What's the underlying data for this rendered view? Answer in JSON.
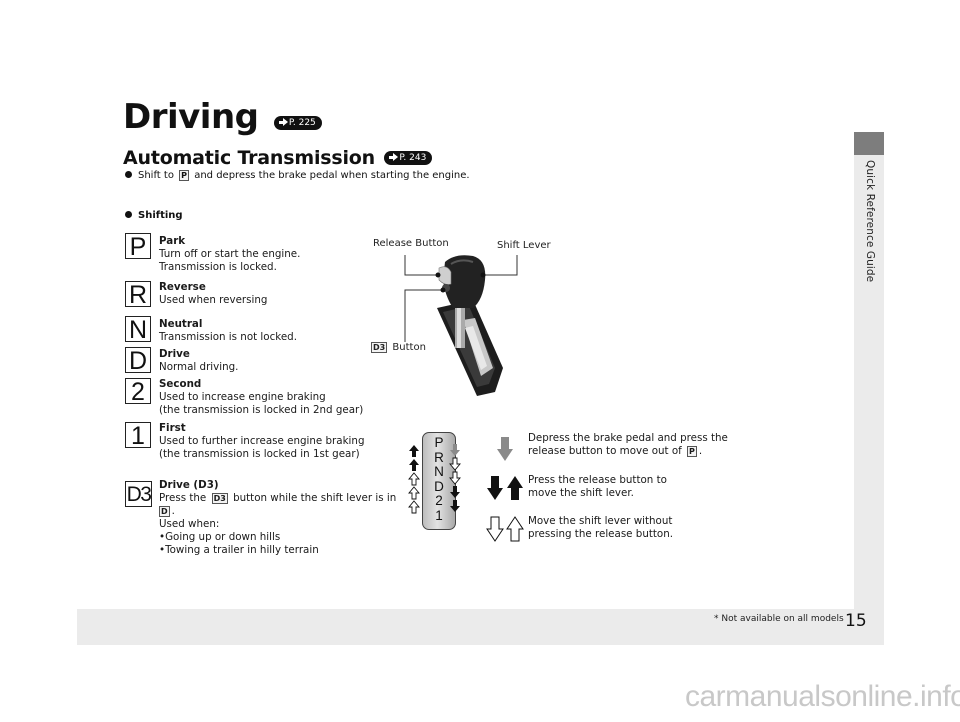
{
  "page": {
    "title": "Driving",
    "title_ref": "P. 225",
    "section": "Automatic Transmission",
    "section_ref": "P. 243",
    "intro_bullet": {
      "before": "Shift to",
      "key": "P",
      "after": "and depress the brake pedal when starting the engine."
    },
    "subsection": "Shifting",
    "side_tab_label": "Quick Reference Guide",
    "footnote": "* Not available on all models",
    "page_number": "15",
    "watermark": "carmanualsonline.info"
  },
  "gears": [
    {
      "symbol": "P",
      "name": "Park",
      "lines": [
        "Turn off or start the engine.",
        "Transmission is locked."
      ]
    },
    {
      "symbol": "R",
      "name": "Reverse",
      "lines": [
        "Used when reversing"
      ]
    },
    {
      "symbol": "N",
      "name": "Neutral",
      "lines": [
        "Transmission is not locked."
      ]
    },
    {
      "symbol": "D",
      "name": "Drive",
      "lines": [
        "Normal driving."
      ]
    },
    {
      "symbol": "2",
      "name": "Second",
      "lines": [
        "Used to increase engine braking",
        "(the transmission is locked in 2nd gear)"
      ]
    },
    {
      "symbol": "1",
      "name": "First",
      "lines": [
        "Used to further increase engine braking",
        "(the transmission is locked in 1st gear)"
      ]
    },
    {
      "symbol": "D3",
      "name": "Drive (D3)",
      "line1_before": "Press the",
      "line1_key": "D3",
      "line1_after": "button while the shift lever is in",
      "line2_key": "D",
      "line2_after": ".",
      "lines": [
        "Used when:",
        "•Going up or down hills",
        "•Towing a trailer in hilly terrain"
      ]
    }
  ],
  "lever_diagram": {
    "release_button_label": "Release Button",
    "shift_lever_label": "Shift Lever",
    "d3_button_key": "D3",
    "d3_button_label": "Button"
  },
  "gate": {
    "positions": [
      "P",
      "R",
      "N",
      "D",
      "2",
      "1"
    ]
  },
  "legend": [
    {
      "icon": "gray-down-arrow",
      "lines": [
        "Depress the brake pedal and press the"
      ],
      "line2_before": "release button to move out of",
      "line2_key": "P",
      "line2_after": "."
    },
    {
      "icon": "solid-arrows",
      "lines": [
        "Press the release button to",
        "move the shift lever."
      ]
    },
    {
      "icon": "outline-arrows",
      "lines": [
        "Move the shift lever without",
        "pressing the release button."
      ]
    }
  ],
  "colors": {
    "band_gray": "#ebebeb",
    "tab_dark": "#7d7d7d",
    "legend_gray_arrow": "#8a8a8a"
  }
}
